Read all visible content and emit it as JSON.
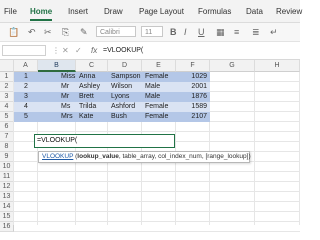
{
  "ribbon": {
    "tabs": [
      {
        "label": "File"
      },
      {
        "label": "Home"
      },
      {
        "label": "Insert"
      },
      {
        "label": "Draw"
      },
      {
        "label": "Page Layout"
      },
      {
        "label": "Formulas"
      },
      {
        "label": "Data"
      },
      {
        "label": "Review"
      }
    ],
    "active_tab": "Home"
  },
  "toolbar": {
    "font_name": "Calibri",
    "font_size": "11"
  },
  "formula_bar": {
    "fx_label": "fx",
    "content": "=VLOOKUP("
  },
  "grid": {
    "columns": [
      "A",
      "B",
      "C",
      "D",
      "E",
      "F",
      "G",
      "H"
    ],
    "selected_column": "B",
    "rows": [
      "1",
      "2",
      "3",
      "4",
      "5",
      "6",
      "7",
      "8",
      "9",
      "10",
      "11",
      "12",
      "13",
      "14",
      "15",
      "16"
    ],
    "data": [
      {
        "id": "1",
        "title": "Miss",
        "first": "Anna",
        "last": "Sampson",
        "gender": "Female",
        "code": "1029"
      },
      {
        "id": "2",
        "title": "Mr",
        "first": "Ashley",
        "last": "Wilson",
        "gender": "Male",
        "code": "2001"
      },
      {
        "id": "3",
        "title": "Mr",
        "first": "Brett",
        "last": "Lyons",
        "gender": "Male",
        "code": "1876"
      },
      {
        "id": "4",
        "title": "Ms",
        "first": "Trilda",
        "last": "Ashford",
        "gender": "Female",
        "code": "1589"
      },
      {
        "id": "5",
        "title": "Mrs",
        "first": "Kate",
        "last": "Bush",
        "gender": "Female",
        "code": "2107"
      }
    ],
    "edit_cell_value": "=VLOOKUP(",
    "band_color": "#b4c7e7",
    "alt_band_color": "#dae3f3"
  },
  "tooltip": {
    "function_name": "VLOOKUP",
    "open_paren": " (",
    "first_arg": "lookup_value",
    "rest": ", table_array, col_index_num, [range_lookup])"
  },
  "colors": {
    "accent": "#217346"
  }
}
